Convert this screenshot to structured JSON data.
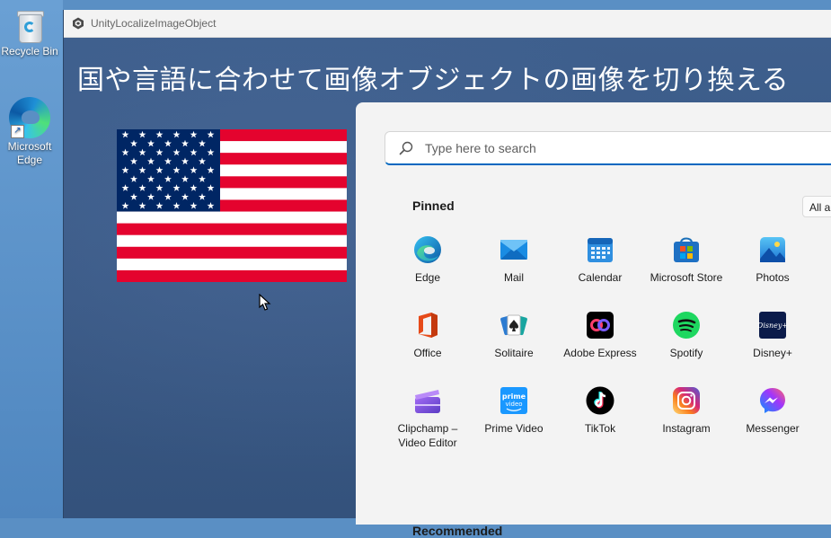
{
  "desktop": {
    "icons": [
      {
        "label": "Recycle Bin",
        "icon": "recycle-bin-icon"
      },
      {
        "label": "Microsoft Edge",
        "icon": "edge-icon"
      }
    ]
  },
  "window": {
    "title": "UnityLocalizeImageObject",
    "heading": "国や言語に合わせて画像オブジェクトの画像を切り換える",
    "flag": "us-flag"
  },
  "start_menu": {
    "search_placeholder": "Type here to search",
    "pinned_label": "Pinned",
    "all_apps_label": "All ap",
    "recommended_label": "Recommended",
    "apps": [
      {
        "label": "Edge",
        "icon": "edge-icon"
      },
      {
        "label": "Mail",
        "icon": "mail-icon"
      },
      {
        "label": "Calendar",
        "icon": "calendar-icon"
      },
      {
        "label": "Microsoft Store",
        "icon": "store-icon"
      },
      {
        "label": "Photos",
        "icon": "photos-icon"
      },
      {
        "label": "Office",
        "icon": "office-icon"
      },
      {
        "label": "Solitaire",
        "icon": "solitaire-icon"
      },
      {
        "label": "Adobe Express",
        "icon": "adobe-express-icon"
      },
      {
        "label": "Spotify",
        "icon": "spotify-icon"
      },
      {
        "label": "Disney+",
        "icon": "disney-plus-icon"
      },
      {
        "label": "Clipchamp – Video Editor",
        "icon": "clipchamp-icon"
      },
      {
        "label": "Prime Video",
        "icon": "prime-video-icon"
      },
      {
        "label": "TikTok",
        "icon": "tiktok-icon"
      },
      {
        "label": "Instagram",
        "icon": "instagram-icon"
      },
      {
        "label": "Messenger",
        "icon": "messenger-icon"
      }
    ]
  },
  "colors": {
    "window_bg": "#3d5f8c",
    "accent": "#0067c0",
    "flag_red": "#e4032e",
    "flag_blue": "#002664"
  }
}
